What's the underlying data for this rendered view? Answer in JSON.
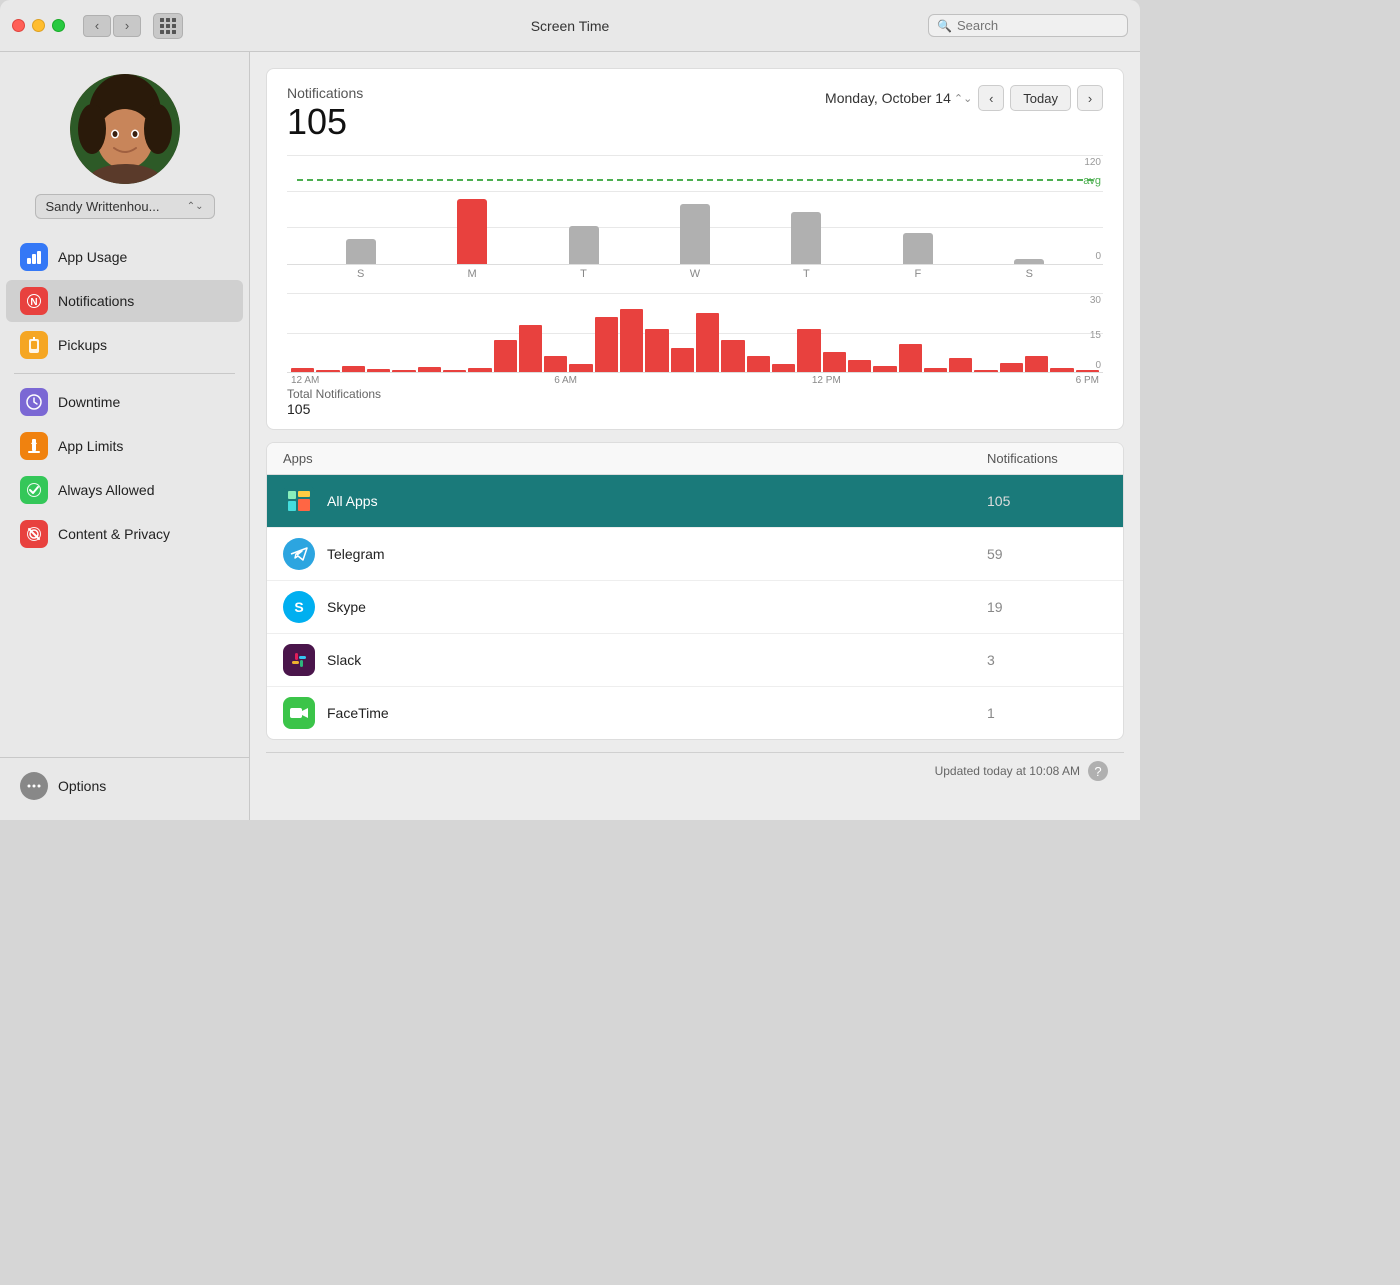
{
  "titlebar": {
    "title": "Screen Time",
    "search_placeholder": "Search"
  },
  "sidebar": {
    "user_name": "Sandy Writtenhou...",
    "items": [
      {
        "id": "app-usage",
        "label": "App Usage",
        "icon_color": "icon-blue",
        "icon_char": "≡"
      },
      {
        "id": "notifications",
        "label": "Notifications",
        "icon_color": "icon-red",
        "icon_char": "●"
      },
      {
        "id": "pickups",
        "label": "Pickups",
        "icon_color": "icon-orange",
        "icon_char": "↩"
      }
    ],
    "items2": [
      {
        "id": "downtime",
        "label": "Downtime",
        "icon_color": "icon-purple",
        "icon_char": "☾"
      },
      {
        "id": "app-limits",
        "label": "App Limits",
        "icon_color": "icon-orange2",
        "icon_char": "⏳"
      },
      {
        "id": "always-allowed",
        "label": "Always Allowed",
        "icon_color": "icon-green",
        "icon_char": "✓"
      },
      {
        "id": "content-privacy",
        "label": "Content & Privacy",
        "icon_color": "icon-red2",
        "icon_char": "⊘"
      }
    ],
    "options_label": "Options"
  },
  "chart": {
    "section_title": "Notifications",
    "total_count": "105",
    "date_label": "Monday, October 14",
    "today_label": "Today",
    "avg_label": "avg",
    "y_max": "120",
    "y_zero": "0",
    "days": [
      "S",
      "M",
      "T",
      "W",
      "T",
      "F",
      "S"
    ],
    "day_heights": [
      25,
      72,
      40,
      60,
      55,
      30,
      0
    ],
    "day_colors": [
      "gray",
      "red",
      "gray",
      "gray",
      "gray",
      "gray",
      "gray"
    ],
    "hourly_y_max": "30",
    "hourly_y_mid": "15",
    "hourly_y_zero": "0",
    "hourly_labels": [
      "12 AM",
      "6 AM",
      "12 PM",
      "6 PM"
    ],
    "total_notifications_label": "Total Notifications",
    "total_notifications_value": "105"
  },
  "apps_table": {
    "col_apps": "Apps",
    "col_notifications": "Notifications",
    "rows": [
      {
        "name": "All Apps",
        "count": "105",
        "selected": true,
        "icon_type": "all-apps"
      },
      {
        "name": "Telegram",
        "count": "59",
        "selected": false,
        "icon_type": "telegram"
      },
      {
        "name": "Skype",
        "count": "19",
        "selected": false,
        "icon_type": "skype"
      },
      {
        "name": "Slack",
        "count": "3",
        "selected": false,
        "icon_type": "slack"
      },
      {
        "name": "FaceTime",
        "count": "1",
        "selected": false,
        "icon_type": "facetime"
      }
    ]
  },
  "status_bar": {
    "updated_text": "Updated today at 10:08 AM",
    "help_label": "?"
  }
}
